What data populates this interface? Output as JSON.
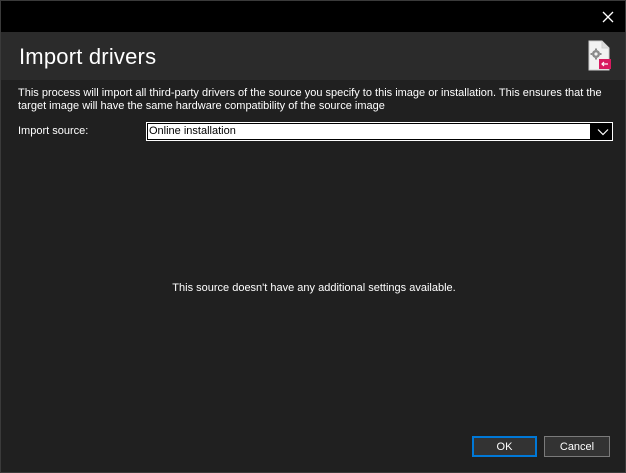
{
  "window": {
    "close_symbol": "✕"
  },
  "header": {
    "title": "Import drivers",
    "icon": "gear-document-icon"
  },
  "description": "This process will import all third-party drivers of the source you specify to this image or installation. This ensures that the target image will have the same hardware compatibility of the source image",
  "import_source": {
    "label": "Import source:",
    "value": "Online installation"
  },
  "message": "This source doesn't have any additional settings available.",
  "buttons": {
    "ok": "OK",
    "cancel": "Cancel"
  },
  "colors": {
    "background": "#202020",
    "header": "#2b2b2b",
    "accent": "#0078d7",
    "icon_accent": "#d81b60"
  }
}
